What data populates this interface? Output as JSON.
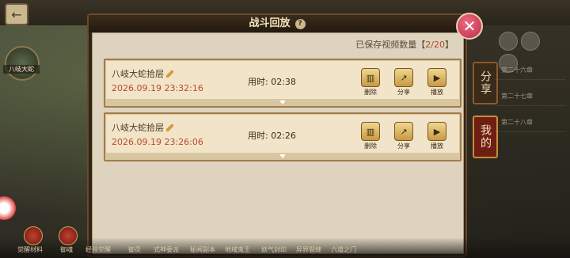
{
  "dialog": {
    "title": "战斗回放",
    "help_glyph": "?",
    "saved_label": "已保存视频数量【",
    "saved_count": "2/20",
    "saved_close": "】",
    "close_glyph": "✕"
  },
  "records": [
    {
      "title": "八岐大蛇拾层",
      "date": "2026.09.19 23:32:16",
      "duration": "用时: 02:38",
      "delete": "删除",
      "share": "分享",
      "play": "播放"
    },
    {
      "title": "八岐大蛇拾层",
      "date": "2026.09.19 23:26:06",
      "duration": "用时: 02:26",
      "delete": "删除",
      "share": "分享",
      "play": "播放"
    }
  ],
  "right_tabs": {
    "share": "分享",
    "mine": "我的"
  },
  "right_list": [
    "第二十六章",
    "第二十七章",
    "第二十八章"
  ],
  "left": {
    "portrait_label": "八岐大蛇"
  },
  "bottom_nav": [
    "觉醒材料",
    "御魂",
    "经验觉醒",
    "御灵",
    "式神委派",
    "秘闻副本",
    "地域鬼王",
    "妖气封印",
    "异界裂缝",
    "六道之门"
  ],
  "icons": {
    "back": "←"
  }
}
